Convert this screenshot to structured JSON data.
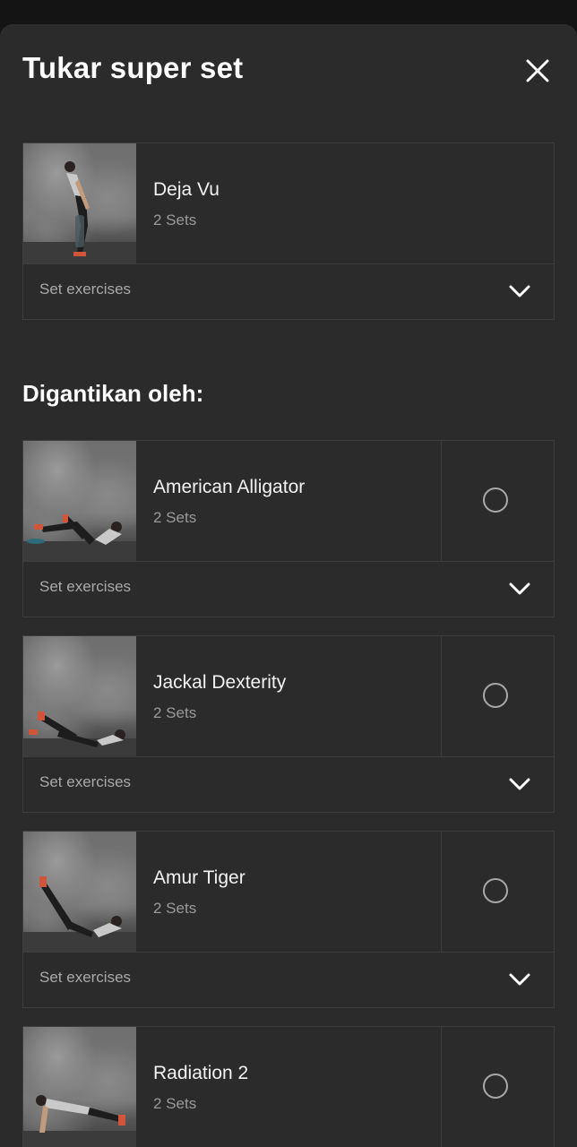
{
  "header": {
    "title": "Tukar super set",
    "close_icon": "close-icon"
  },
  "current": {
    "name": "Deja Vu",
    "sets": "2 Sets",
    "set_exercises_label": "Set exercises"
  },
  "replacement_section": {
    "title": "Digantikan oleh:"
  },
  "options": [
    {
      "name": "American Alligator",
      "sets": "2 Sets",
      "set_exercises_label": "Set exercises",
      "selected": false
    },
    {
      "name": "Jackal Dexterity",
      "sets": "2 Sets",
      "set_exercises_label": "Set exercises",
      "selected": false
    },
    {
      "name": "Amur Tiger",
      "sets": "2 Sets",
      "set_exercises_label": "Set exercises",
      "selected": false
    },
    {
      "name": "Radiation 2",
      "sets": "2 Sets",
      "selected": false
    }
  ],
  "colors": {
    "sheet_bg": "#2b2b2b",
    "backdrop": "#141414",
    "border": "#3d3d3d",
    "muted_text": "#9a9a9a"
  }
}
